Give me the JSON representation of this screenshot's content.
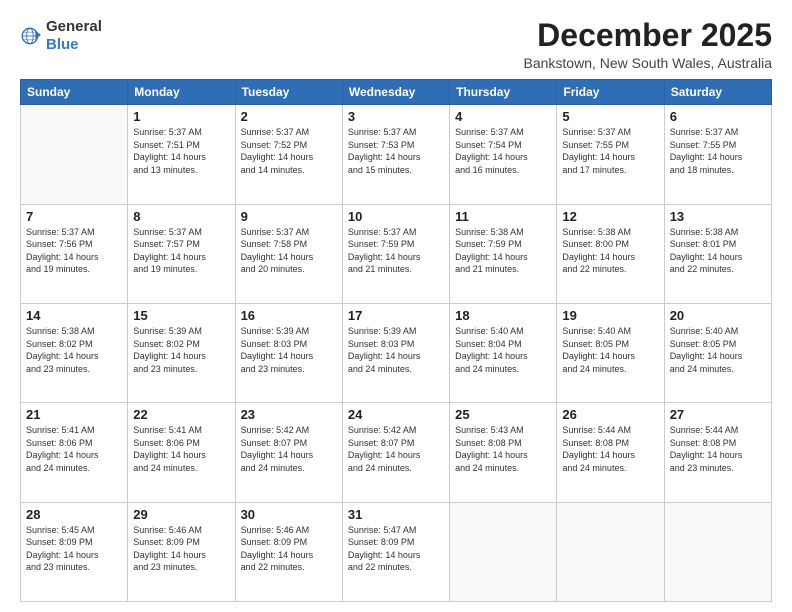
{
  "header": {
    "logo_general": "General",
    "logo_blue": "Blue",
    "title": "December 2025",
    "location": "Bankstown, New South Wales, Australia"
  },
  "weekdays": [
    "Sunday",
    "Monday",
    "Tuesday",
    "Wednesday",
    "Thursday",
    "Friday",
    "Saturday"
  ],
  "weeks": [
    [
      {
        "day": "",
        "info": ""
      },
      {
        "day": "1",
        "info": "Sunrise: 5:37 AM\nSunset: 7:51 PM\nDaylight: 14 hours\nand 13 minutes."
      },
      {
        "day": "2",
        "info": "Sunrise: 5:37 AM\nSunset: 7:52 PM\nDaylight: 14 hours\nand 14 minutes."
      },
      {
        "day": "3",
        "info": "Sunrise: 5:37 AM\nSunset: 7:53 PM\nDaylight: 14 hours\nand 15 minutes."
      },
      {
        "day": "4",
        "info": "Sunrise: 5:37 AM\nSunset: 7:54 PM\nDaylight: 14 hours\nand 16 minutes."
      },
      {
        "day": "5",
        "info": "Sunrise: 5:37 AM\nSunset: 7:55 PM\nDaylight: 14 hours\nand 17 minutes."
      },
      {
        "day": "6",
        "info": "Sunrise: 5:37 AM\nSunset: 7:55 PM\nDaylight: 14 hours\nand 18 minutes."
      }
    ],
    [
      {
        "day": "7",
        "info": "Sunrise: 5:37 AM\nSunset: 7:56 PM\nDaylight: 14 hours\nand 19 minutes."
      },
      {
        "day": "8",
        "info": "Sunrise: 5:37 AM\nSunset: 7:57 PM\nDaylight: 14 hours\nand 19 minutes."
      },
      {
        "day": "9",
        "info": "Sunrise: 5:37 AM\nSunset: 7:58 PM\nDaylight: 14 hours\nand 20 minutes."
      },
      {
        "day": "10",
        "info": "Sunrise: 5:37 AM\nSunset: 7:59 PM\nDaylight: 14 hours\nand 21 minutes."
      },
      {
        "day": "11",
        "info": "Sunrise: 5:38 AM\nSunset: 7:59 PM\nDaylight: 14 hours\nand 21 minutes."
      },
      {
        "day": "12",
        "info": "Sunrise: 5:38 AM\nSunset: 8:00 PM\nDaylight: 14 hours\nand 22 minutes."
      },
      {
        "day": "13",
        "info": "Sunrise: 5:38 AM\nSunset: 8:01 PM\nDaylight: 14 hours\nand 22 minutes."
      }
    ],
    [
      {
        "day": "14",
        "info": "Sunrise: 5:38 AM\nSunset: 8:02 PM\nDaylight: 14 hours\nand 23 minutes."
      },
      {
        "day": "15",
        "info": "Sunrise: 5:39 AM\nSunset: 8:02 PM\nDaylight: 14 hours\nand 23 minutes."
      },
      {
        "day": "16",
        "info": "Sunrise: 5:39 AM\nSunset: 8:03 PM\nDaylight: 14 hours\nand 23 minutes."
      },
      {
        "day": "17",
        "info": "Sunrise: 5:39 AM\nSunset: 8:03 PM\nDaylight: 14 hours\nand 24 minutes."
      },
      {
        "day": "18",
        "info": "Sunrise: 5:40 AM\nSunset: 8:04 PM\nDaylight: 14 hours\nand 24 minutes."
      },
      {
        "day": "19",
        "info": "Sunrise: 5:40 AM\nSunset: 8:05 PM\nDaylight: 14 hours\nand 24 minutes."
      },
      {
        "day": "20",
        "info": "Sunrise: 5:40 AM\nSunset: 8:05 PM\nDaylight: 14 hours\nand 24 minutes."
      }
    ],
    [
      {
        "day": "21",
        "info": "Sunrise: 5:41 AM\nSunset: 8:06 PM\nDaylight: 14 hours\nand 24 minutes."
      },
      {
        "day": "22",
        "info": "Sunrise: 5:41 AM\nSunset: 8:06 PM\nDaylight: 14 hours\nand 24 minutes."
      },
      {
        "day": "23",
        "info": "Sunrise: 5:42 AM\nSunset: 8:07 PM\nDaylight: 14 hours\nand 24 minutes."
      },
      {
        "day": "24",
        "info": "Sunrise: 5:42 AM\nSunset: 8:07 PM\nDaylight: 14 hours\nand 24 minutes."
      },
      {
        "day": "25",
        "info": "Sunrise: 5:43 AM\nSunset: 8:08 PM\nDaylight: 14 hours\nand 24 minutes."
      },
      {
        "day": "26",
        "info": "Sunrise: 5:44 AM\nSunset: 8:08 PM\nDaylight: 14 hours\nand 24 minutes."
      },
      {
        "day": "27",
        "info": "Sunrise: 5:44 AM\nSunset: 8:08 PM\nDaylight: 14 hours\nand 23 minutes."
      }
    ],
    [
      {
        "day": "28",
        "info": "Sunrise: 5:45 AM\nSunset: 8:09 PM\nDaylight: 14 hours\nand 23 minutes."
      },
      {
        "day": "29",
        "info": "Sunrise: 5:46 AM\nSunset: 8:09 PM\nDaylight: 14 hours\nand 23 minutes."
      },
      {
        "day": "30",
        "info": "Sunrise: 5:46 AM\nSunset: 8:09 PM\nDaylight: 14 hours\nand 22 minutes."
      },
      {
        "day": "31",
        "info": "Sunrise: 5:47 AM\nSunset: 8:09 PM\nDaylight: 14 hours\nand 22 minutes."
      },
      {
        "day": "",
        "info": ""
      },
      {
        "day": "",
        "info": ""
      },
      {
        "day": "",
        "info": ""
      }
    ]
  ]
}
